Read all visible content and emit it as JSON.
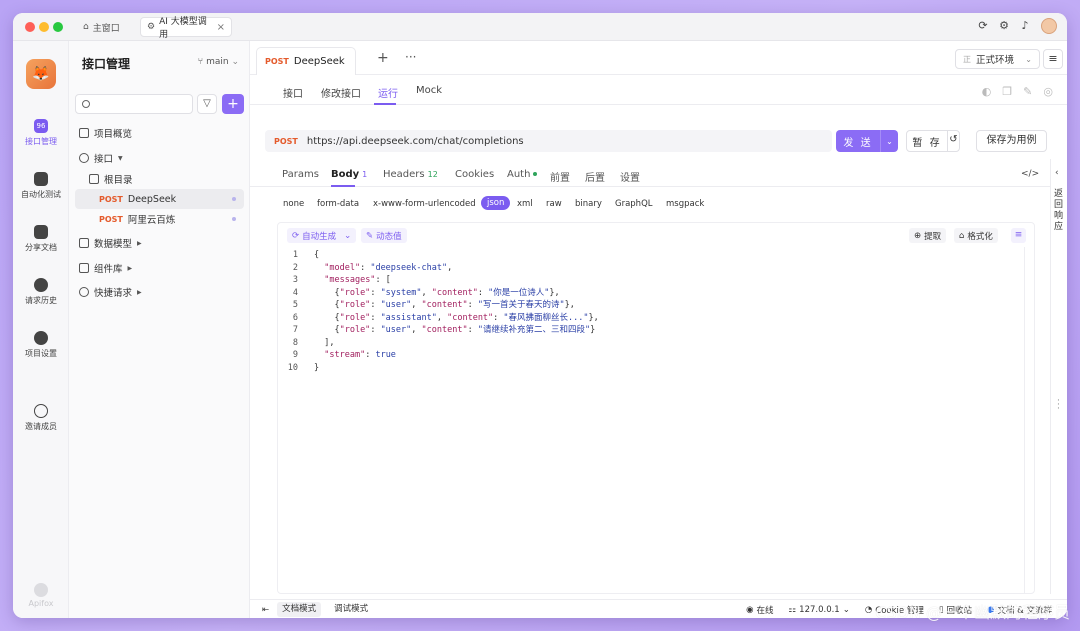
{
  "window": {
    "home_tab": "主窗口",
    "active_tab": "AI 大模型调用",
    "close_glyph": "×"
  },
  "leftnav": {
    "items": [
      {
        "label": "接口管理",
        "icon": "api-icon",
        "badge": "96"
      },
      {
        "label": "自动化测试",
        "icon": "automation-icon"
      },
      {
        "label": "分享文档",
        "icon": "book-icon"
      },
      {
        "label": "请求历史",
        "icon": "clock-icon"
      },
      {
        "label": "项目设置",
        "icon": "gear-icon"
      },
      {
        "label": "邀请成员",
        "icon": "add-user-icon"
      }
    ],
    "footer": "Apifox"
  },
  "sidebar": {
    "title": "接口管理",
    "branch": "main",
    "tree": [
      {
        "label": "项目概览"
      },
      {
        "label": "接口"
      },
      {
        "label": "根目录"
      },
      {
        "method": "POST",
        "label": "DeepSeek"
      },
      {
        "method": "POST",
        "label": "阿里云百炼"
      },
      {
        "label": "数据模型"
      },
      {
        "label": "组件库"
      },
      {
        "label": "快捷请求"
      }
    ]
  },
  "request_tab": {
    "method": "POST",
    "name": "DeepSeek"
  },
  "environment": "正式环境",
  "subtabs": [
    "接口",
    "修改接口",
    "运行",
    "Mock"
  ],
  "url": {
    "method": "POST",
    "value": "https://api.deepseek.com/chat/completions"
  },
  "buttons": {
    "send": "发 送",
    "save": "暂 存",
    "save_case": "保存为用例"
  },
  "param_tabs": [
    {
      "label": "Params"
    },
    {
      "label": "Body",
      "count": "1"
    },
    {
      "label": "Headers",
      "count": "12"
    },
    {
      "label": "Cookies"
    },
    {
      "label": "Auth"
    },
    {
      "label": "前置"
    },
    {
      "label": "后置"
    },
    {
      "label": "设置"
    }
  ],
  "body_types": [
    "none",
    "form-data",
    "x-www-form-urlencoded",
    "json",
    "xml",
    "raw",
    "binary",
    "GraphQL",
    "msgpack"
  ],
  "editor": {
    "auto_generate": "自动生成",
    "dynamic_value": "动态值",
    "extract": "提取",
    "format": "格式化",
    "lines": [
      "{",
      "  \"model\": \"deepseek-chat\",",
      "  \"messages\": [",
      "    {\"role\": \"system\", \"content\": \"你是一位诗人\"},",
      "    {\"role\": \"user\", \"content\": \"写一首关于春天的诗\"},",
      "    {\"role\": \"assistant\", \"content\": \"春风拂面柳丝长...\"},",
      "    {\"role\": \"user\", \"content\": \"请继续补充第二、三和四段\"}",
      "  ],",
      "  \"stream\": true",
      "}"
    ]
  },
  "right_panel": {
    "label": "返回响应"
  },
  "statusbar": {
    "doc_mode": "文档模式",
    "debug_mode": "调试模式",
    "online": "在线",
    "host": "127.0.0.1",
    "cookie": "Cookie 管理",
    "recycle": "回收站",
    "docs": "文档 & 交流群"
  },
  "watermark": "CSDN @一个幽默的程序员",
  "colors": {
    "accent": "#7b5cf0",
    "method": "#e45a2b"
  }
}
